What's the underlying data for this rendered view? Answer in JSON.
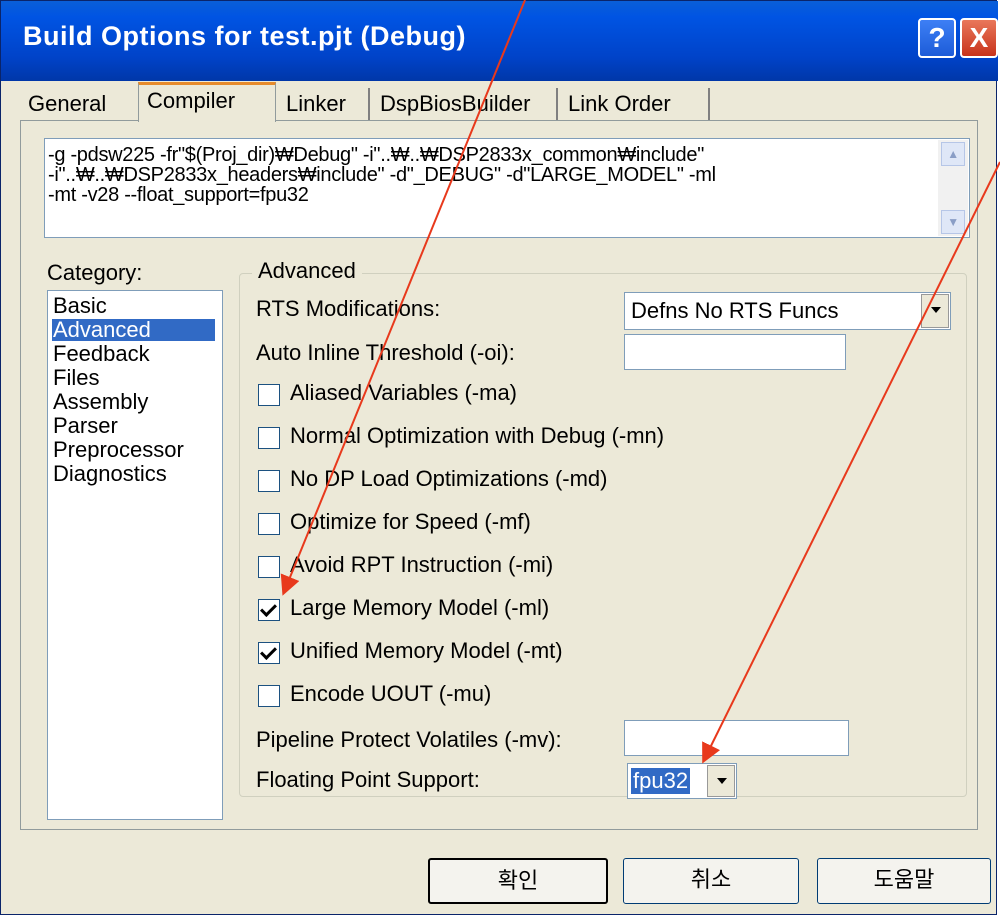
{
  "window": {
    "title": "Build Options for test.pjt (Debug)",
    "help_label": "?",
    "close_label": "X"
  },
  "tabs": [
    {
      "label": "General"
    },
    {
      "label": "Compiler"
    },
    {
      "label": "Linker"
    },
    {
      "label": "DspBiosBuilder"
    },
    {
      "label": "Link Order"
    }
  ],
  "command_line": [
    "-g -pdsw225 -fr\"$(Proj_dir)₩Debug\" -i\"..₩..₩DSP2833x_common₩include\"",
    "-i\"..₩..₩DSP2833x_headers₩include\" -d\"_DEBUG\" -d\"LARGE_MODEL\" -ml",
    "-mt -v28 --float_support=fpu32"
  ],
  "category": {
    "label": "Category:",
    "items": [
      "Basic",
      "Advanced",
      "Feedback",
      "Files",
      "Assembly",
      "Parser",
      "Preprocessor",
      "Diagnostics"
    ],
    "selected": "Advanced"
  },
  "advanced": {
    "group_title": "Advanced",
    "rts_label": "RTS Modifications:",
    "rts_value": "Defns No RTS Funcs",
    "inline_label": "Auto Inline Threshold (-oi):",
    "inline_value": "",
    "checkboxes": [
      {
        "label": "Aliased Variables (-ma)",
        "checked": false
      },
      {
        "label": "Normal Optimization with Debug (-mn)",
        "checked": false
      },
      {
        "label": "No DP Load Optimizations (-md)",
        "checked": false
      },
      {
        "label": "Optimize for Speed (-mf)",
        "checked": false
      },
      {
        "label": "Avoid RPT Instruction (-mi)",
        "checked": false
      },
      {
        "label": "Large Memory Model (-ml)",
        "checked": true
      },
      {
        "label": "Unified Memory Model (-mt)",
        "checked": true
      },
      {
        "label": "Encode UOUT (-mu)",
        "checked": false
      }
    ],
    "pipeline_label": "Pipeline Protect Volatiles (-mv):",
    "pipeline_value": "",
    "fp_label": "Floating Point Support:",
    "fp_value": "fpu32"
  },
  "buttons": {
    "ok": "확인",
    "cancel": "취소",
    "help": "도움말"
  },
  "colors": {
    "title_bar": "#0054e3",
    "selection": "#316ac5",
    "annotation_arrow": "#e8391c"
  }
}
